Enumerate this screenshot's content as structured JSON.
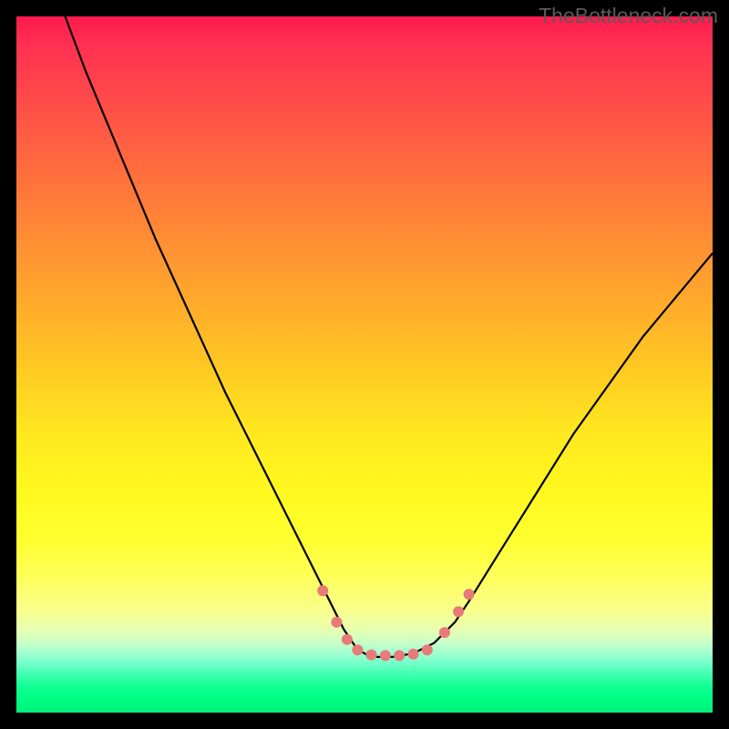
{
  "watermark": "TheBottleneck.com",
  "chart_data": {
    "type": "line",
    "title": "",
    "xlabel": "",
    "ylabel": "",
    "xlim": [
      0,
      100
    ],
    "ylim": [
      0,
      100
    ],
    "series": [
      {
        "name": "bottleneck-curve",
        "x": [
          7,
          10,
          15,
          20,
          25,
          30,
          35,
          40,
          44,
          47,
          49,
          51,
          54,
          57,
          60,
          63,
          65,
          70,
          75,
          80,
          85,
          90,
          95,
          100
        ],
        "y": [
          100,
          92,
          80,
          68,
          57,
          46,
          36,
          26,
          18,
          12,
          9,
          8,
          8,
          8.5,
          10,
          13,
          16,
          24,
          32,
          40,
          47,
          54,
          60,
          66
        ]
      }
    ],
    "markers": {
      "name": "highlight-points",
      "color": "#e87a7a",
      "points": [
        {
          "x": 44,
          "y": 17.5,
          "r": 6
        },
        {
          "x": 46,
          "y": 13,
          "r": 6
        },
        {
          "x": 47.5,
          "y": 10.5,
          "r": 6
        },
        {
          "x": 49,
          "y": 9,
          "r": 6
        },
        {
          "x": 51,
          "y": 8.3,
          "r": 6
        },
        {
          "x": 53,
          "y": 8.2,
          "r": 6
        },
        {
          "x": 55,
          "y": 8.2,
          "r": 6
        },
        {
          "x": 57,
          "y": 8.4,
          "r": 6
        },
        {
          "x": 59,
          "y": 9,
          "r": 6
        },
        {
          "x": 61.5,
          "y": 11.5,
          "r": 6
        },
        {
          "x": 63.5,
          "y": 14.5,
          "r": 6
        },
        {
          "x": 65,
          "y": 17,
          "r": 6
        }
      ]
    }
  }
}
